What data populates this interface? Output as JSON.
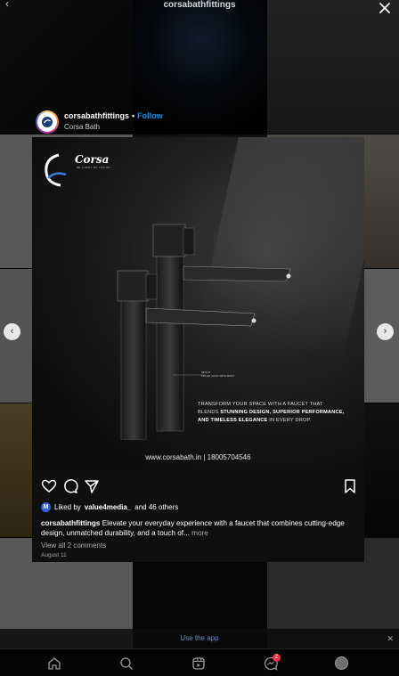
{
  "modal": {
    "title": "corsabathfittings"
  },
  "post": {
    "username": "corsabathfittings",
    "separator": "•",
    "follow_label": "Follow",
    "subtitle": "Corsa Bath",
    "image": {
      "brand": "Corsa",
      "brand_sub": "BE A PART OF LUXURY",
      "callout_line1": "SPOUT",
      "callout_line2": "FILLER COCK WITH BODY",
      "tagline_line1": "Transform your space with a faucet that",
      "tagline_bold1": "Stunning design, superior performance,",
      "tagline_pre": "blends",
      "tagline_bold2": "and timeless elegance",
      "tagline_post": "in every drop.",
      "website": "www.corsabath.in | 18005704546"
    },
    "liked_avatar_letter": "M",
    "liked_by_prefix": "Liked by",
    "liked_by_user": "value4media_",
    "liked_by_suffix": "and 46 others",
    "caption_user": "corsabathfittings",
    "caption_text": "Elevate your everyday experience with a faucet that combines cutting-edge design, unmatched durability, and a touch of...",
    "caption_more": "more",
    "view_comments": "View all 2 comments",
    "date": "August 11"
  },
  "use_app": {
    "label": "Use the app"
  },
  "nav": {
    "messages_badge": "2",
    "icons": [
      "home-icon",
      "search-icon",
      "reels-icon",
      "messages-icon",
      "profile-icon"
    ]
  }
}
